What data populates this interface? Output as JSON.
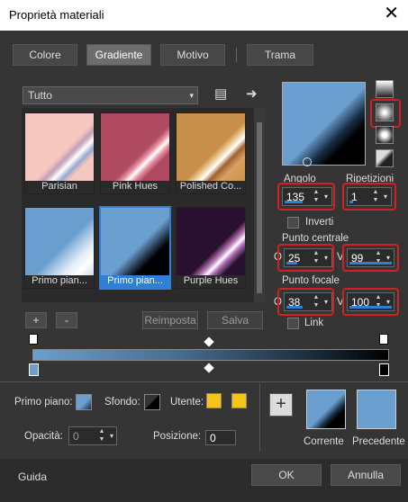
{
  "window": {
    "title": "Proprietà materiali",
    "close": "✕"
  },
  "tabs": [
    {
      "label": "Colore"
    },
    {
      "label": "Gradiente"
    },
    {
      "label": "Motivo"
    },
    {
      "label": "Trama"
    }
  ],
  "category": {
    "value": "Tutto",
    "arrow": "▾"
  },
  "header_icons": {
    "library": "▤",
    "next": "➜"
  },
  "gradients": [
    {
      "name": "Parisian"
    },
    {
      "name": "Pink Hues"
    },
    {
      "name": "Polished Co..."
    },
    {
      "name": "Primo pian..."
    },
    {
      "name": "Primo pian..."
    },
    {
      "name": "Purple Hues"
    }
  ],
  "list_buttons": {
    "add": "+",
    "remove": "-",
    "reset": "Reimposta",
    "save": "Salva"
  },
  "angle": {
    "label": "Angolo",
    "value": "135"
  },
  "repeats": {
    "label": "Ripetizioni",
    "value": "1"
  },
  "invert": {
    "label": "Inverti"
  },
  "center": {
    "label": "Punto centrale",
    "o_label": "O",
    "v_label": "V",
    "h": "25",
    "v": "99"
  },
  "focal": {
    "label": "Punto focale",
    "o_label": "O",
    "v_label": "V",
    "h": "38",
    "v": "100"
  },
  "link": {
    "label": "Link"
  },
  "bottom": {
    "foreground_label": "Primo piano:",
    "background_label": "Sfondo:",
    "user_label": "Utente:",
    "opacity_label": "Opacità:",
    "opacity_value": "0",
    "position_label": "Posizione:",
    "position_value": "0",
    "current_label": "Corrente",
    "previous_label": "Precedente",
    "add": "+"
  },
  "footer": {
    "help": "Guida",
    "ok": "OK",
    "cancel": "Annulla"
  },
  "colors": {
    "accent": "#2f7fd6",
    "highlight": "#d42020",
    "user": "#f5c418",
    "preview": "#6a9fcf"
  }
}
